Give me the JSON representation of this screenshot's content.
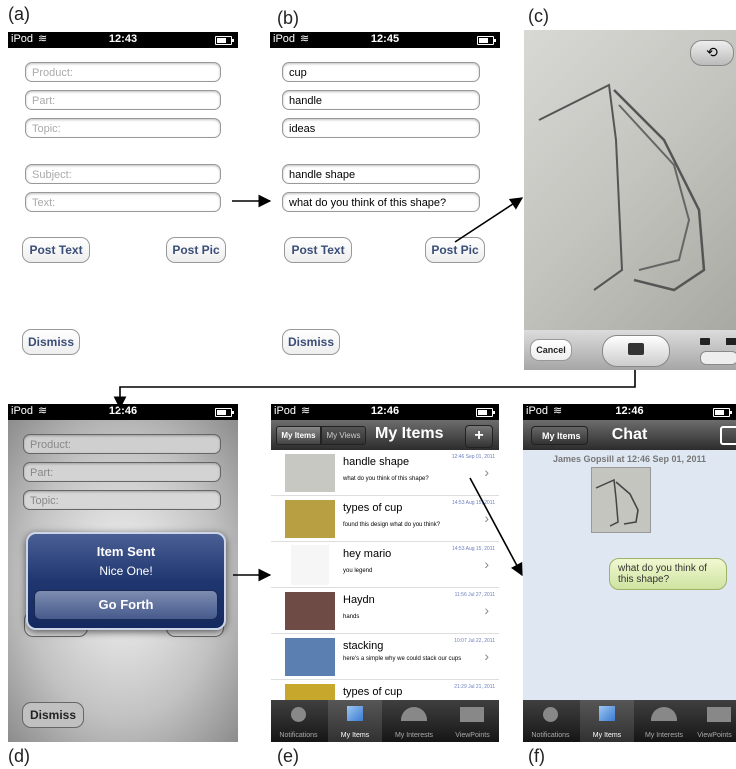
{
  "labels": [
    "(a)",
    "(b)",
    "(c)",
    "(d)",
    "(e)",
    "(f)"
  ],
  "status": {
    "carrier": "iPod",
    "time_a": "12:43",
    "time_b": "12:45",
    "time_d": "12:46",
    "time_e": "12:46",
    "time_f": "12:46"
  },
  "form": {
    "product_placeholder": "Product:",
    "part_placeholder": "Part:",
    "topic_placeholder": "Topic:",
    "subject_placeholder": "Subject:",
    "text_placeholder": "Text:",
    "product_value": "cup",
    "part_value": "handle",
    "topic_value": "ideas",
    "subject_value": "handle shape",
    "text_value": "what do you think of this shape?",
    "post_text": "Post Text",
    "post_pic": "Post Pic",
    "dismiss": "Dismiss"
  },
  "camera": {
    "cancel": "Cancel"
  },
  "alert": {
    "title": "Item Sent",
    "message": "Nice One!",
    "button": "Go Forth"
  },
  "items_screen": {
    "back": "My Items",
    "views": "My Views",
    "title": "My Items",
    "add": "+",
    "rows": [
      {
        "title": "handle shape",
        "date": "12:46 Sep 01, 2011",
        "desc": "what do you think of this shape?"
      },
      {
        "title": "types of cup",
        "date": "14:53 Aug 15, 2011",
        "desc": "found this design what do you think?"
      },
      {
        "title": "hey mario",
        "date": "14:53 Aug 15, 2011",
        "desc": "you legend"
      },
      {
        "title": "Haydn",
        "date": "11:56 Jul 27, 2011",
        "desc": "hands"
      },
      {
        "title": "stacking",
        "date": "10:07 Jul 22, 2011",
        "desc": "here's a simple why we could stack our cups"
      },
      {
        "title": "types of cup",
        "date": "21:29 Jul 21, 2011",
        "desc": ""
      }
    ]
  },
  "chat": {
    "back": "My Items",
    "title": "Chat",
    "header": "James Gopsill at 12:46 Sep 01, 2011",
    "bubble": "what do you think of this shape?"
  },
  "tabs": [
    "Notifications",
    "My Items",
    "My Interests",
    "ViewPoints"
  ],
  "colors": {
    "button_text": "#3b4e78",
    "chat_bg": "#dfe7f2",
    "bubble": "#e4f0b8",
    "alert_blue": "#1d3a78"
  }
}
